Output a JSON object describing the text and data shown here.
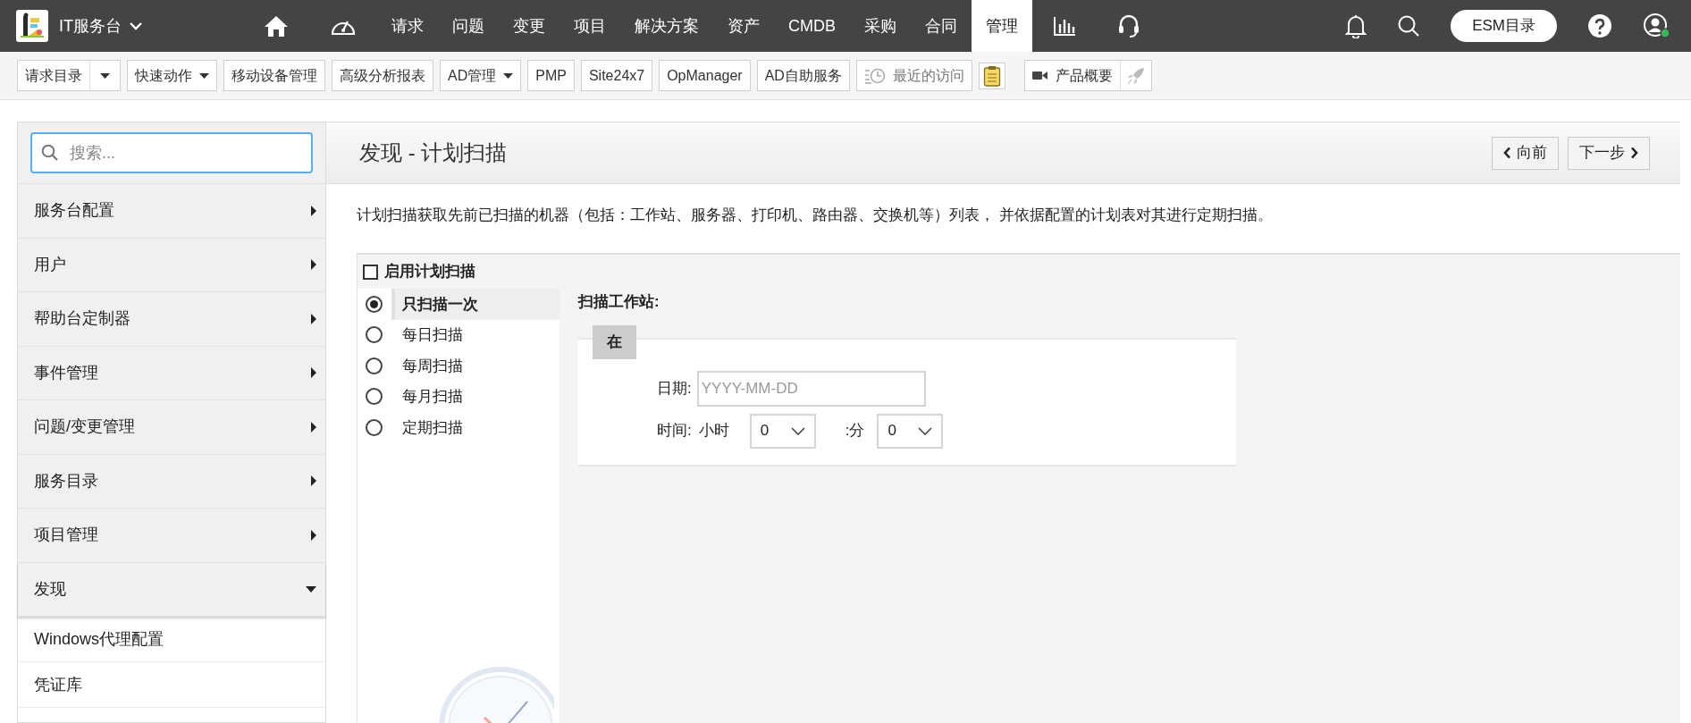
{
  "app": {
    "title": "IT服务台"
  },
  "nav": [
    {
      "kind": "home",
      "selected": false
    },
    {
      "kind": "dashboard",
      "selected": false
    },
    {
      "kind": "text",
      "label": "请求",
      "selected": false
    },
    {
      "kind": "text",
      "label": "问题",
      "selected": false
    },
    {
      "kind": "text",
      "label": "变更",
      "selected": false
    },
    {
      "kind": "text",
      "label": "项目",
      "selected": false
    },
    {
      "kind": "text",
      "label": "解决方案",
      "selected": false
    },
    {
      "kind": "text",
      "label": "资产",
      "selected": false
    },
    {
      "kind": "text",
      "label": "CMDB",
      "selected": false
    },
    {
      "kind": "text",
      "label": "采购",
      "selected": false
    },
    {
      "kind": "text",
      "label": "合同",
      "selected": false
    },
    {
      "kind": "text",
      "label": "管理",
      "selected": true
    },
    {
      "kind": "reports",
      "selected": false
    },
    {
      "kind": "support",
      "selected": false
    }
  ],
  "esm_button": "ESM目录",
  "toolbar": [
    {
      "kind": "split",
      "label": "请求目录"
    },
    {
      "kind": "dropdown",
      "label": "快速动作"
    },
    {
      "kind": "plain",
      "label": "移动设备管理"
    },
    {
      "kind": "plain",
      "label": "高级分析报表"
    },
    {
      "kind": "dropdown",
      "label": "AD管理"
    },
    {
      "kind": "plain",
      "label": "PMP"
    },
    {
      "kind": "plain",
      "label": "Site24x7"
    },
    {
      "kind": "plain",
      "label": "OpManager"
    },
    {
      "kind": "plain",
      "label": "AD自助服务"
    },
    {
      "kind": "recent",
      "label": "最近的访问"
    },
    {
      "kind": "notes"
    },
    {
      "kind": "product",
      "label": "产品概要"
    }
  ],
  "sidebar": {
    "search_placeholder": "搜索...",
    "items": [
      {
        "label": "服务台配置",
        "expanded": false
      },
      {
        "label": "用户",
        "expanded": false
      },
      {
        "label": "帮助台定制器",
        "expanded": false
      },
      {
        "label": "事件管理",
        "expanded": false
      },
      {
        "label": "问题/变更管理",
        "expanded": false
      },
      {
        "label": "服务目录",
        "expanded": false
      },
      {
        "label": "项目管理",
        "expanded": false
      },
      {
        "label": "发现",
        "expanded": true,
        "children": [
          {
            "label": "Windows代理配置"
          },
          {
            "label": "凭证库"
          }
        ]
      }
    ]
  },
  "page": {
    "title": "发现 - 计划扫描",
    "prev_button": "向前",
    "next_button": "下一步",
    "description": "计划扫描获取先前已扫描的机器（包括：工作站、服务器、打印机、路由器、交换机等）列表， 并依据配置的计划表对其进行定期扫描。",
    "enable": {
      "label": "启用计划扫描",
      "checked": false
    },
    "options": [
      {
        "label": "只扫描一次",
        "selected": true
      },
      {
        "label": "每日扫描",
        "selected": false
      },
      {
        "label": "每周扫描",
        "selected": false
      },
      {
        "label": "每月扫描",
        "selected": false
      },
      {
        "label": "定期扫描",
        "selected": false
      }
    ],
    "section_title": "扫描工作站:",
    "tab": "在",
    "date_label": "日期:",
    "date_placeholder": "YYYY-MM-DD",
    "time_label": "时间:",
    "hour_label": "小时",
    "hour_value": "0",
    "minute_label": ":分",
    "minute_value": "0"
  }
}
